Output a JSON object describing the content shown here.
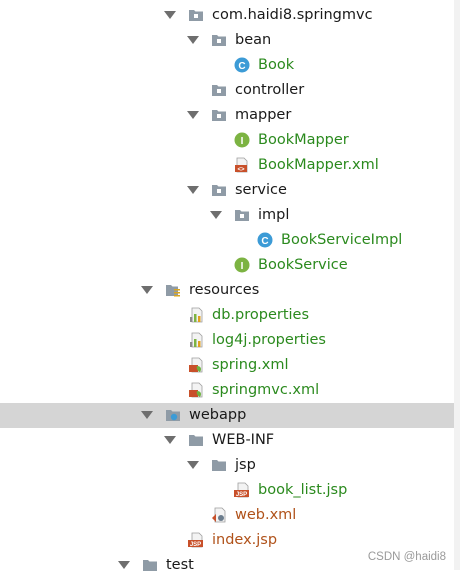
{
  "tree": {
    "package_name": "com.haidi8.springmvc",
    "bean": "bean",
    "book_class": "Book",
    "controller": "controller",
    "mapper": "mapper",
    "book_mapper": "BookMapper",
    "book_mapper_xml": "BookMapper.xml",
    "service": "service",
    "impl": "impl",
    "book_service_impl": "BookServiceImpl",
    "book_service": "BookService",
    "resources": "resources",
    "db_properties": "db.properties",
    "log4j_properties": "log4j.properties",
    "spring_xml": "spring.xml",
    "springmvc_xml": "springmvc.xml",
    "webapp": "webapp",
    "web_inf": "WEB-INF",
    "jsp_folder": "jsp",
    "book_list_jsp": "book_list.jsp",
    "web_xml": "web.xml",
    "index_jsp": "index.jsp",
    "test": "test"
  },
  "icon_badges": {
    "class_letter": "C",
    "interface_letter": "I",
    "jsp_tag": "JSP",
    "xml_tag": "<>"
  },
  "watermark": "CSDN @haidi8",
  "colors": {
    "text": "#1a1a1a",
    "green_file": "#2b8a1e",
    "orange_file": "#b0521a",
    "selected_row": "#d5d5d5",
    "folder": "#8f9ba6",
    "class_icon": "#3c9bd6",
    "interface_icon": "#7cb342"
  }
}
